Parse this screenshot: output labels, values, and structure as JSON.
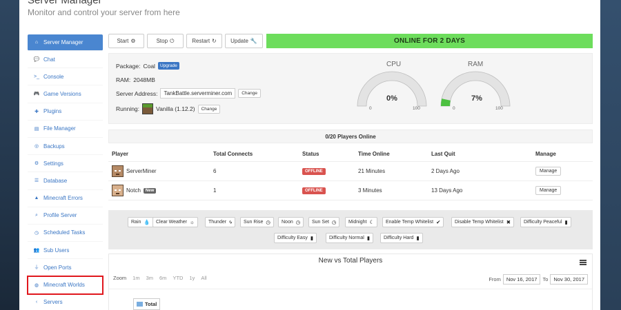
{
  "header": {
    "title": "Server Manager",
    "subtitle": "Monitor and control your server from here"
  },
  "sidebar": {
    "items": [
      {
        "label": "Server Manager",
        "icon": "home-icon",
        "glyph": "⌂"
      },
      {
        "label": "Chat",
        "icon": "chat-icon",
        "glyph": "💬"
      },
      {
        "label": "Console",
        "icon": "terminal-icon",
        "glyph": ">_"
      },
      {
        "label": "Game Versions",
        "icon": "gamepad-icon",
        "glyph": "🎮"
      },
      {
        "label": "Plugins",
        "icon": "puzzle-icon",
        "glyph": "✚"
      },
      {
        "label": "File Manager",
        "icon": "file-icon",
        "glyph": "▤"
      },
      {
        "label": "Backups",
        "icon": "backup-icon",
        "glyph": "◎"
      },
      {
        "label": "Settings",
        "icon": "gear-icon",
        "glyph": "⚙"
      },
      {
        "label": "Database",
        "icon": "database-icon",
        "glyph": "☰"
      },
      {
        "label": "Minecraft Errors",
        "icon": "warning-icon",
        "glyph": "▲"
      },
      {
        "label": "Profile Server",
        "icon": "search-icon",
        "glyph": "⌕"
      },
      {
        "label": "Scheduled Tasks",
        "icon": "clock-icon",
        "glyph": "◷"
      },
      {
        "label": "Sub Users",
        "icon": "users-icon",
        "glyph": "👥"
      },
      {
        "label": "Open Ports",
        "icon": "plug-icon",
        "glyph": "⏚"
      },
      {
        "label": "Minecraft Worlds",
        "icon": "globe-icon",
        "glyph": "◍"
      },
      {
        "label": "Servers",
        "icon": "chevron-left-icon",
        "glyph": "‹"
      }
    ]
  },
  "toolbar": {
    "start": "Start",
    "stop": "Stop",
    "restart": "Restart",
    "update": "Update",
    "status": "ONLINE FOR 2 DAYS"
  },
  "info": {
    "package_label": "Package:",
    "package_value": "Coal",
    "upgrade": "Upgrade",
    "ram_label": "RAM:",
    "ram_value": "2048MB",
    "address_label": "Server Address:",
    "address_value": "TankBattle.serverminer.com",
    "change": "Change",
    "running_label": "Running:",
    "running_value": "Vanilla (1.12.2)"
  },
  "gauges": {
    "cpu": {
      "label": "CPU",
      "value_text": "0%",
      "value": 0,
      "min": "0",
      "max": "100"
    },
    "ram": {
      "label": "RAM",
      "value_text": "7%",
      "value": 7,
      "min": "0",
      "max": "100"
    },
    "fill_color": "#4cc040",
    "track_color": "#e3e3e3"
  },
  "players": {
    "summary": "0/20 Players Online",
    "columns": [
      "Player",
      "Total Connects",
      "Status",
      "Time Online",
      "Last Quit",
      "Manage"
    ],
    "rows": [
      {
        "name": "ServerMiner",
        "badge": "",
        "connects": "6",
        "status": "OFFLINE",
        "time": "21 Minutes",
        "last_quit": "2 Days Ago",
        "manage": "Manage"
      },
      {
        "name": "Notch",
        "badge": "New",
        "connects": "1",
        "status": "OFFLINE",
        "time": "3 Minutes",
        "last_quit": "13 Days Ago",
        "manage": "Manage"
      }
    ]
  },
  "commands": [
    {
      "label": "Rain",
      "icon": "drop-icon",
      "glyph": "💧"
    },
    {
      "label": "Clear Weather",
      "icon": "sun-icon",
      "glyph": "☼"
    },
    {
      "label": "Thunder",
      "icon": "bolt-icon",
      "glyph": "ϟ"
    },
    {
      "label": "Sun Rise",
      "icon": "clock-icon",
      "glyph": "◷"
    },
    {
      "label": "Noon",
      "icon": "clock-icon",
      "glyph": "◷"
    },
    {
      "label": "Sun Set",
      "icon": "clock-icon",
      "glyph": "◷"
    },
    {
      "label": "Midnight",
      "icon": "moon-icon",
      "glyph": "☾"
    },
    {
      "label": "Enable Temp Whitelist",
      "icon": "check-icon",
      "glyph": "✔"
    },
    {
      "label": "Disable Temp Whitelist",
      "icon": "x-icon",
      "glyph": "✖"
    },
    {
      "label": "Difficulty Peaceful",
      "icon": "book-icon",
      "glyph": "▮"
    },
    {
      "label": "Difficulty Easy",
      "icon": "book-icon",
      "glyph": "▮"
    },
    {
      "label": "Difficulty Normal",
      "icon": "book-icon",
      "glyph": "▮"
    },
    {
      "label": "Difficulty Hard",
      "icon": "book-icon",
      "glyph": "▮"
    }
  ],
  "chart": {
    "title": "New vs Total Players",
    "zoom_label": "Zoom",
    "zoom_options": [
      "1m",
      "3m",
      "6m",
      "YTD",
      "1y",
      "All"
    ],
    "from_label": "From",
    "from_value": "Nov 16, 2017",
    "to_label": "To",
    "to_value": "Nov 30, 2017",
    "legend": "Total"
  },
  "colors": {
    "accent": "#4a86d0",
    "online": "#6ddd5c",
    "offline": "#d9534f",
    "highlight": "#e0161c"
  }
}
